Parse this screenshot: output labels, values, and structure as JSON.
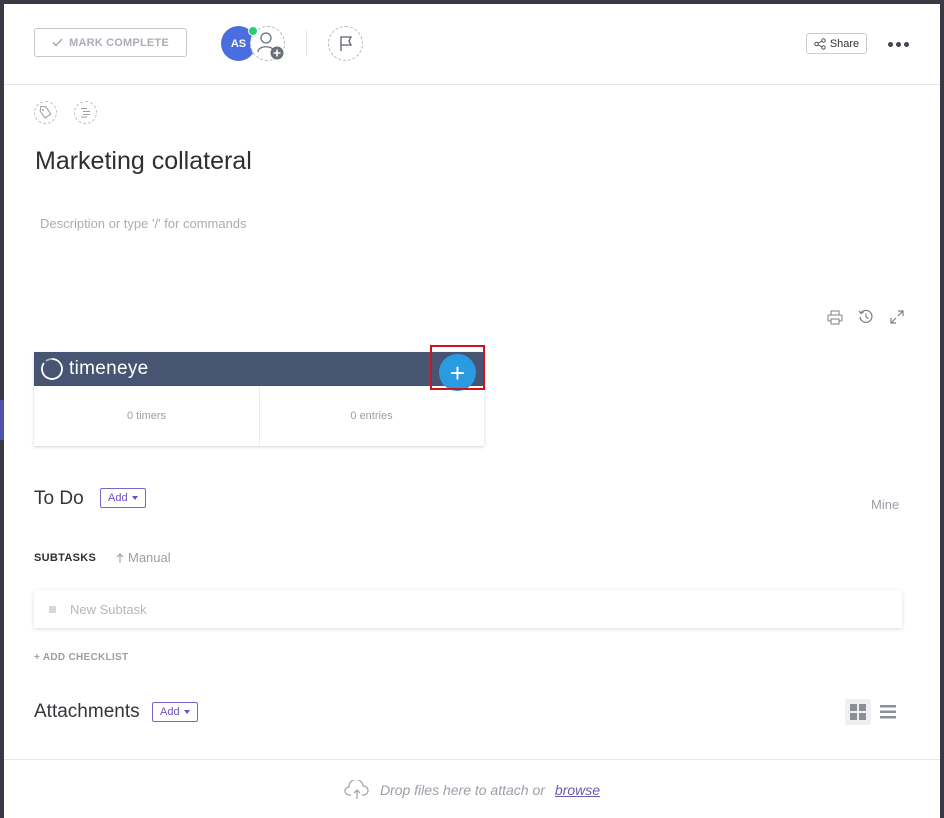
{
  "header": {
    "mark_complete_label": "MARK COMPLETE",
    "avatar_initials": "AS",
    "share_label": "Share"
  },
  "task": {
    "title": "Marketing collateral",
    "description_placeholder": "Description or type '/' for commands"
  },
  "timeneye": {
    "brand": "timeneye",
    "add_symbol": "+",
    "timers_label": "0 timers",
    "entries_label": "0 entries"
  },
  "todo": {
    "status_label": "To Do",
    "add_label": "Add",
    "mine_label": "Mine"
  },
  "subtasks": {
    "label": "SUBTASKS",
    "sort_label": "Manual",
    "new_placeholder": "New Subtask",
    "add_checklist_label": "+ ADD CHECKLIST"
  },
  "attachments": {
    "title": "Attachments",
    "add_label": "Add",
    "drop_text": "Drop files here to attach or",
    "browse_label": "browse"
  },
  "colors": {
    "accent_purple": "#7b68ee",
    "timeneye_bar": "#475573",
    "timeneye_add": "#2a9be0",
    "highlight": "#d0141c",
    "avatar": "#4a6ee0"
  }
}
